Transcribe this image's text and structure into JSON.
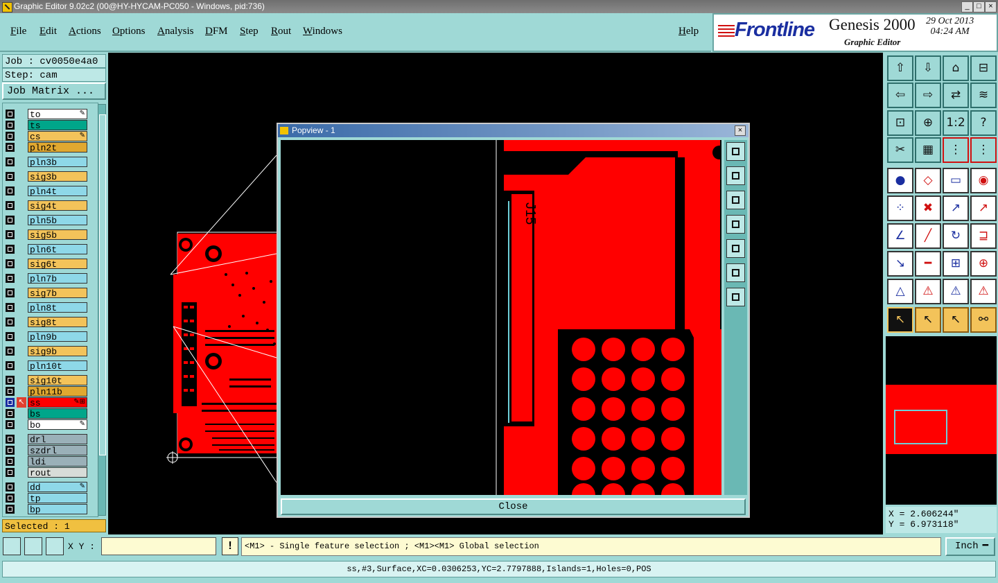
{
  "window": {
    "title": "Graphic Editor 9.02c2 (00@HY-HYCAM-PC050 - Windows, pid:736)"
  },
  "menu": [
    "File",
    "Edit",
    "Actions",
    "Options",
    "Analysis",
    "DFM",
    "Step",
    "Rout",
    "Windows"
  ],
  "help_label": "Help",
  "brand": {
    "logo": "Frontline",
    "product": "Genesis 2000",
    "subtitle": "Graphic Editor",
    "date": "29 Oct 2013",
    "time": "04:24 AM"
  },
  "job": {
    "job_label": "Job : cv0050e4a0",
    "step_label": "Step: cam",
    "matrix_button": "Job Matrix ..."
  },
  "layers": [
    {
      "name": "to",
      "color": "#ffffff",
      "flag": "✎"
    },
    {
      "name": "ts",
      "color": "#00a68a",
      "flag": ""
    },
    {
      "name": "cs",
      "color": "#f3c35a",
      "flag": "✎"
    },
    {
      "name": "pln2t",
      "color": "#e0a830",
      "flag": ""
    },
    {
      "name": "pln3b",
      "color": "#8ed8e8",
      "flag": ""
    },
    {
      "name": "sig3b",
      "color": "#f3c35a",
      "flag": ""
    },
    {
      "name": "pln4t",
      "color": "#8ed8e8",
      "flag": ""
    },
    {
      "name": "sig4t",
      "color": "#f3c35a",
      "flag": ""
    },
    {
      "name": "pln5b",
      "color": "#8ed8e8",
      "flag": ""
    },
    {
      "name": "sig5b",
      "color": "#f3c35a",
      "flag": ""
    },
    {
      "name": "pln6t",
      "color": "#8ed8e8",
      "flag": ""
    },
    {
      "name": "sig6t",
      "color": "#f3c35a",
      "flag": ""
    },
    {
      "name": "pln7b",
      "color": "#8ed8e8",
      "flag": ""
    },
    {
      "name": "sig7b",
      "color": "#f3c35a",
      "flag": ""
    },
    {
      "name": "pln8t",
      "color": "#8ed8e8",
      "flag": ""
    },
    {
      "name": "sig8t",
      "color": "#f3c35a",
      "flag": ""
    },
    {
      "name": "pln9b",
      "color": "#8ed8e8",
      "flag": ""
    },
    {
      "name": "sig9b",
      "color": "#f3c35a",
      "flag": ""
    },
    {
      "name": "pln10t",
      "color": "#8ed8e8",
      "flag": ""
    },
    {
      "name": "sig10t",
      "color": "#f3c35a",
      "flag": ""
    },
    {
      "name": "pln11b",
      "color": "#e0a830",
      "flag": ""
    },
    {
      "name": "ss",
      "color": "#ff0000",
      "flag": "✎⊞",
      "active": true
    },
    {
      "name": "bs",
      "color": "#00a68a",
      "flag": ""
    },
    {
      "name": "bo",
      "color": "#ffffff",
      "flag": "✎"
    },
    {
      "name": "drl",
      "color": "#9ab0b8",
      "flag": ""
    },
    {
      "name": "szdrl",
      "color": "#9ab0b8",
      "flag": ""
    },
    {
      "name": "ldi",
      "color": "#9ab0b8",
      "flag": ""
    },
    {
      "name": "rout",
      "color": "#d8dcd8",
      "flag": ""
    },
    {
      "name": "dd",
      "color": "#8ed8e8",
      "flag": "✎"
    },
    {
      "name": "tp",
      "color": "#8ed8e8",
      "flag": ""
    },
    {
      "name": "bp",
      "color": "#8ed8e8",
      "flag": ""
    }
  ],
  "selected_label": "Selected : 1",
  "popview": {
    "title": "Popview - 1",
    "close_label": "Close",
    "silkscreen_text": "J15"
  },
  "toolbar_icons": [
    [
      "home-up-icon",
      "home-down-icon",
      "home-icon",
      "split-window-icon"
    ],
    [
      "pan-left-icon",
      "pan-right-icon",
      "swap-icon",
      "snake-icon"
    ],
    [
      "fit-icon",
      "center-icon",
      "one-to-one-icon",
      "help-icon"
    ],
    [
      "measure-icon",
      "grid-icon",
      "layer-color-icon",
      "layer-color-icon-2"
    ],
    [
      "add-pad-icon",
      "add-line-icon",
      "ruler-icon",
      "pad-shape-icon"
    ],
    [
      "connect-icon",
      "delete-feature-icon",
      "move-icon",
      "copy-icon"
    ],
    [
      "angle-icon",
      "line-icon",
      "arc-icon",
      "mirror-icon"
    ],
    [
      "resize-icon",
      "cut-line-icon",
      "measure-box-icon",
      "pads-icon"
    ],
    [
      "triangle-icon",
      "triangle-a-icon",
      "triangle-b-icon",
      "triangle-c-icon"
    ],
    [
      "select-arrow-icon",
      "select-box-icon",
      "select-feature-icon",
      "select-net-icon"
    ]
  ],
  "coords": {
    "x": "X = 2.606244\"",
    "y": "Y = 6.973118\""
  },
  "xy_label": "X Y :",
  "xy_value": "",
  "warn_symbol": "!",
  "hint": "<M1> - Single feature selection ; <M1><M1> Global selection",
  "unit": "Inch",
  "status": "ss,#3,Surface,XC=0.0306253,YC=2.7797888,Islands=1,Holes=0,POS"
}
